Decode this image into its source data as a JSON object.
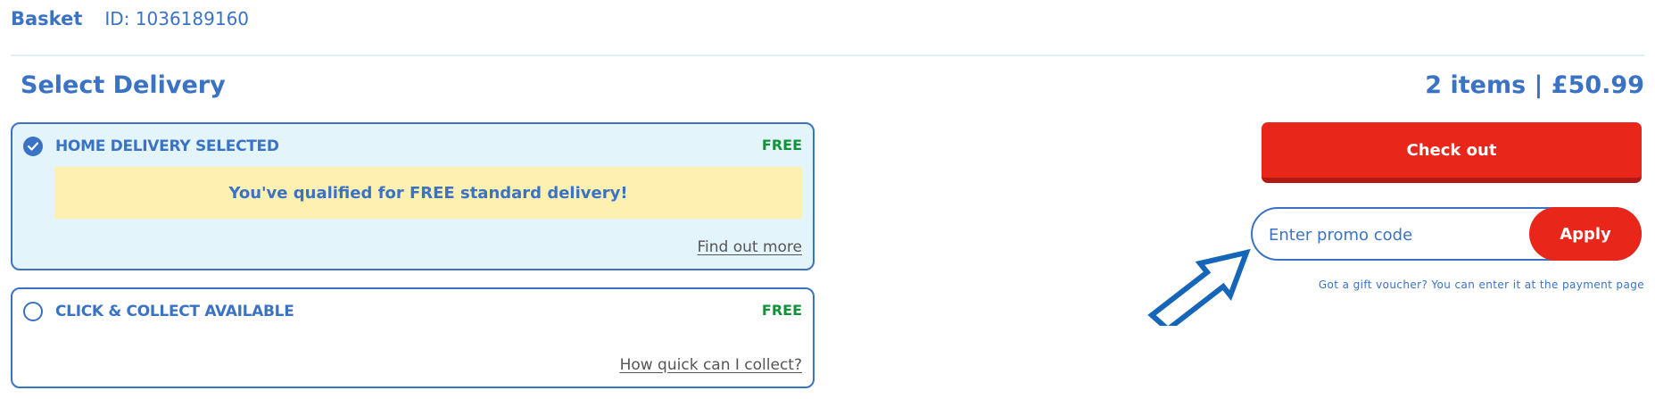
{
  "header": {
    "title": "Basket",
    "id_label": "ID: 1036189160"
  },
  "delivery": {
    "title": "Select Delivery",
    "summary": "2 items | £50.99",
    "options": [
      {
        "label": "HOME DELIVERY SELECTED",
        "price": "FREE",
        "selected": true,
        "notice": "You've qualified for FREE standard delivery!",
        "link": "Find out more"
      },
      {
        "label": "CLICK & COLLECT AVAILABLE",
        "price": "FREE",
        "selected": false,
        "link": "How quick can I collect?"
      }
    ]
  },
  "checkout": {
    "button_label": "Check out",
    "promo_placeholder": "Enter promo code",
    "apply_label": "Apply",
    "voucher_note": "Got a gift voucher? You can enter it at the payment page"
  },
  "colors": {
    "brand_blue": "#3b73c4",
    "checkout_red": "#e8261a",
    "free_green": "#12923a",
    "notice_yellow": "#fef0b0",
    "selected_bg": "#e4f4fb"
  },
  "icons": {
    "selected_radio": "check-circle-icon",
    "empty_radio": "radio-empty-icon",
    "annotation_arrow": "arrow-up-right-icon"
  }
}
